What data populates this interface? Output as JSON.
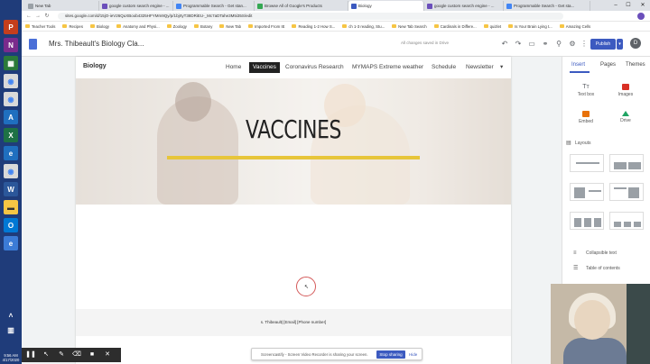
{
  "browser": {
    "tabs": [
      {
        "label": "New Tab",
        "color": "#9aa0a6"
      },
      {
        "label": "google custom search engine - ...",
        "color": "#6b4fbb"
      },
      {
        "label": "Programmable Search - Get stan...",
        "color": "#4285f4"
      },
      {
        "label": "Browse All of Google's Products",
        "color": "#34a853"
      },
      {
        "label": "Biology",
        "color": "#3c5ac0"
      },
      {
        "label": "google custom search engine - ...",
        "color": "#6b4fbb"
      },
      {
        "label": "Programmable Search - Get sta...",
        "color": "#4285f4"
      }
    ],
    "window_controls": {
      "minimize": "–",
      "maximize": "☐",
      "close": "✕"
    },
    "url": "sites.google.com/d/15jO-ieV26QuXBoob4325HFYMm9Qy/p/1bjrtyT38DRiEU-_Mc7aDTahe3M5i35S/edit",
    "bookmarks": [
      "Teacher Tools",
      "Recipes",
      "Biology",
      "Anatomy and Physi...",
      "Zoology",
      "Botany",
      "New Tab",
      "Imported From IE",
      "Reading 1-2 How S...",
      "ch 1-3 reading, Stu...",
      "New Tab Search",
      "Cardinals in Differe...",
      "quizlet",
      "Is Your Brain Lying t...",
      "Amazing Cells"
    ]
  },
  "sites_toolbar": {
    "site_title": "Mrs. Thibeault's Biology Cla...",
    "status": "All changes saved in Drive",
    "publish_label": "Publish",
    "publish_dropdown": "▾",
    "avatar_letter": "D"
  },
  "site": {
    "brand": "Biology",
    "nav": [
      "Home",
      "Vaccines",
      "Coronavirus Research",
      "MYMAPS Extreme weather",
      "Schedule",
      "Newsletter"
    ],
    "nav_more": "▾",
    "hero_title": "VACCINES",
    "footer": "s. Thibeault| [Email] [Phone number]"
  },
  "panel": {
    "tabs": [
      "Insert",
      "Pages",
      "Themes"
    ],
    "insert_items": [
      "Text box",
      "Images",
      "Embed",
      "Drive"
    ],
    "layouts_label": "Layouts",
    "misc": [
      "Collapsible text",
      "Table of contents"
    ]
  },
  "taskbar": {
    "time": "9:56 AM",
    "date": "4/17/2020"
  },
  "screencastify": {
    "banner_text": "Screencastify - Screen Video Recorder is sharing your screen.",
    "stop_label": "Stop sharing",
    "hide_label": "Hide"
  },
  "colors": {
    "accent": "#3c5ac0",
    "hero_line": "#e7c53a"
  }
}
